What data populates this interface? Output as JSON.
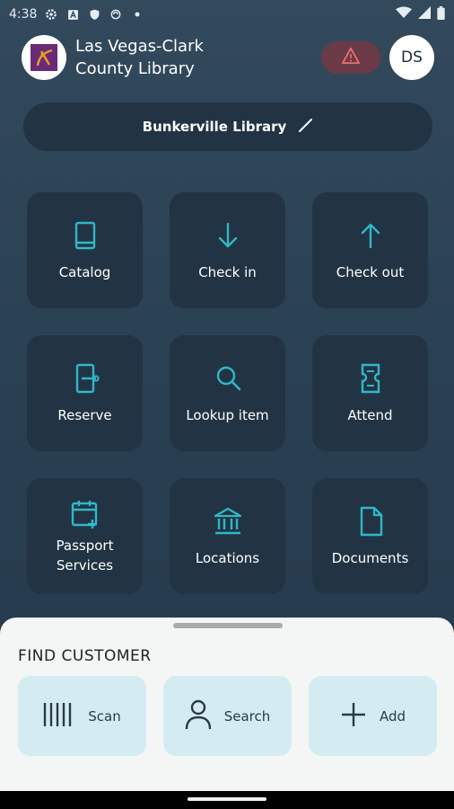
{
  "status_bar": {
    "time": "4:38",
    "icons": [
      "gear-icon",
      "a-icon",
      "shield-icon",
      "sync-icon",
      "dot-icon"
    ],
    "right_icons": [
      "wifi-icon",
      "signal-icon",
      "battery-icon"
    ]
  },
  "header": {
    "title_line1": "Las Vegas-Clark",
    "title_line2": "County Library",
    "avatar_initials": "DS",
    "alert_color": "#6b3a47"
  },
  "location": {
    "name": "Bunkerville Library"
  },
  "tiles": [
    {
      "label": "Catalog",
      "icon": "book-icon"
    },
    {
      "label": "Check in",
      "icon": "arrow-down-icon"
    },
    {
      "label": "Check out",
      "icon": "arrow-up-icon"
    },
    {
      "label": "Reserve",
      "icon": "door-icon"
    },
    {
      "label": "Lookup item",
      "icon": "search-icon"
    },
    {
      "label": "Attend",
      "icon": "ticket-icon"
    },
    {
      "label_line1": "Passport",
      "label_line2": "Services",
      "icon": "calendar-plus-icon"
    },
    {
      "label": "Locations",
      "icon": "bank-icon"
    },
    {
      "label": "Documents",
      "icon": "document-icon"
    }
  ],
  "sheet": {
    "title": "FIND CUSTOMER",
    "actions": [
      {
        "label": "Scan",
        "icon": "barcode-icon"
      },
      {
        "label": "Search",
        "icon": "person-icon"
      },
      {
        "label": "Add",
        "icon": "plus-icon"
      }
    ]
  },
  "colors": {
    "accent": "#2fb8c8",
    "tile_bg": "#223444",
    "action_bg": "#d4ecf1"
  }
}
